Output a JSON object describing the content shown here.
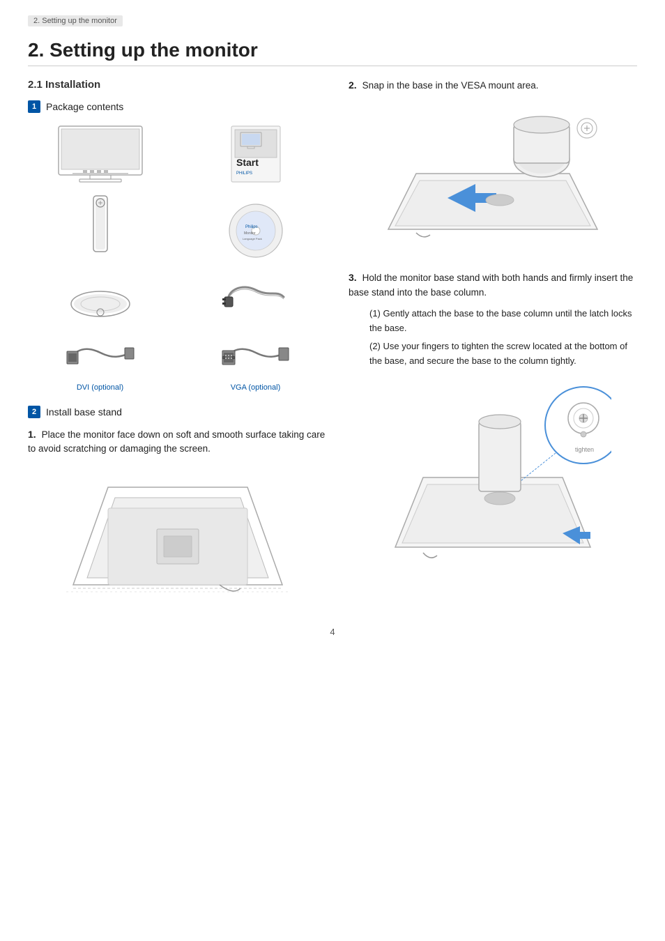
{
  "breadcrumb": "2. Setting up the monitor",
  "title": "2.  Setting up the monitor",
  "section_installation": "2.1 Installation",
  "badge1": "1",
  "badge2": "2",
  "package_contents_label": "Package contents",
  "install_base_label": "Install base stand",
  "step1_text": "Place the monitor face down on soft and smooth surface taking care to avoid scratching or damaging the screen.",
  "step2_text": "Snap in the base in the VESA mount area.",
  "step3_text": "Hold the monitor base stand with both hands and firmly insert the base stand into the base column.",
  "substep1_text": "(1) Gently attach the base to the base column until the latch locks the base.",
  "substep2_text": "(2) Use your fingers to tighten the screw located at the bottom of the base, and secure the base to the column tightly.",
  "dvi_label": "DVI (optional)",
  "vga_label": "VGA (optional)",
  "page_number": "4",
  "colors": {
    "blue": "#0055a5",
    "light_blue": "#4a90d9"
  }
}
